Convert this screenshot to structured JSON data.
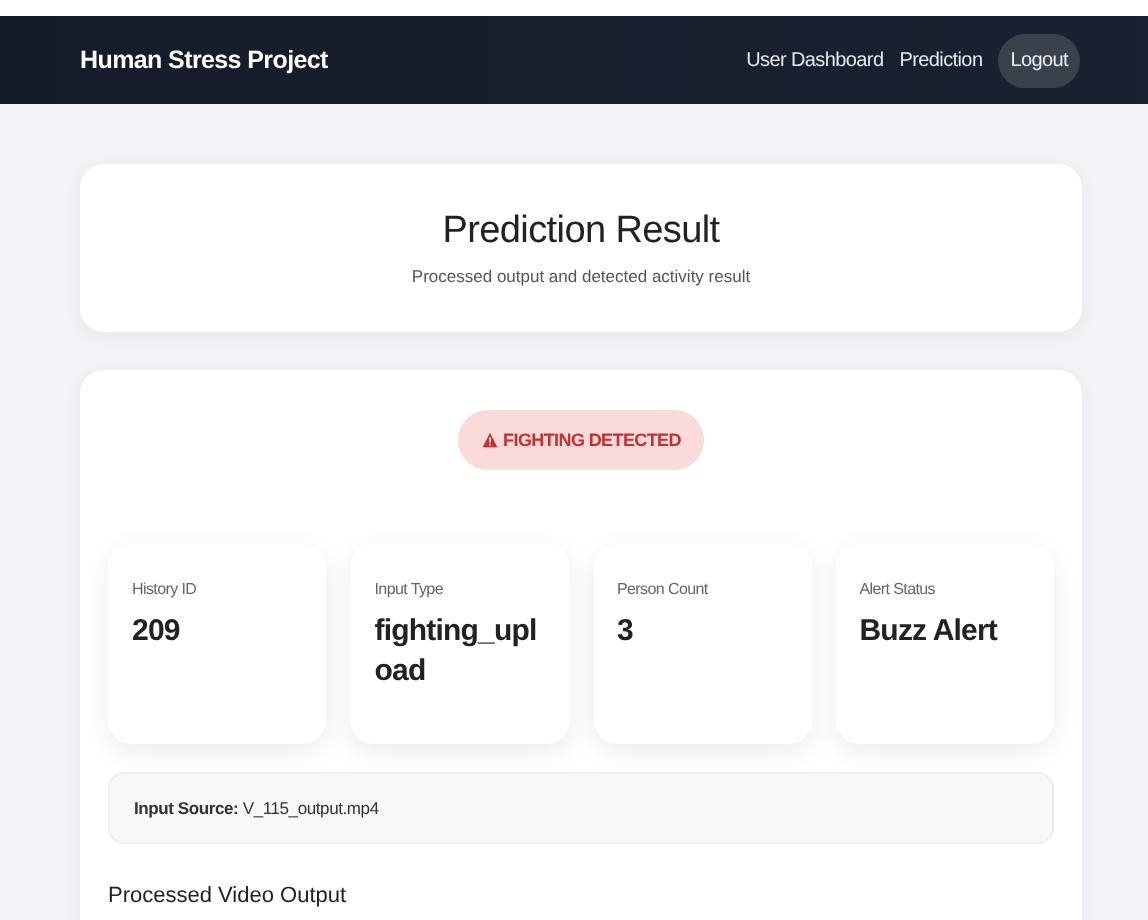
{
  "navbar": {
    "title": "Human Stress Project",
    "links": [
      {
        "label": "User Dashboard",
        "kind": "link"
      },
      {
        "label": "Prediction",
        "kind": "link"
      },
      {
        "label": "Logout",
        "kind": "pill"
      }
    ]
  },
  "header": {
    "title": "Prediction Result",
    "subtitle": "Processed output and detected activity result"
  },
  "alert_badge": {
    "label": "FIGHTING DETECTED"
  },
  "stats": [
    {
      "label": "History ID",
      "value": "209"
    },
    {
      "label": "Input Type",
      "value": "fighting_upload"
    },
    {
      "label": "Person Count",
      "value": "3"
    },
    {
      "label": "Alert Status",
      "value": "Buzz Alert"
    }
  ],
  "input_source": "**Input Source:** V_115_output.mp4",
  "section_title": "Processed Video Output"
}
